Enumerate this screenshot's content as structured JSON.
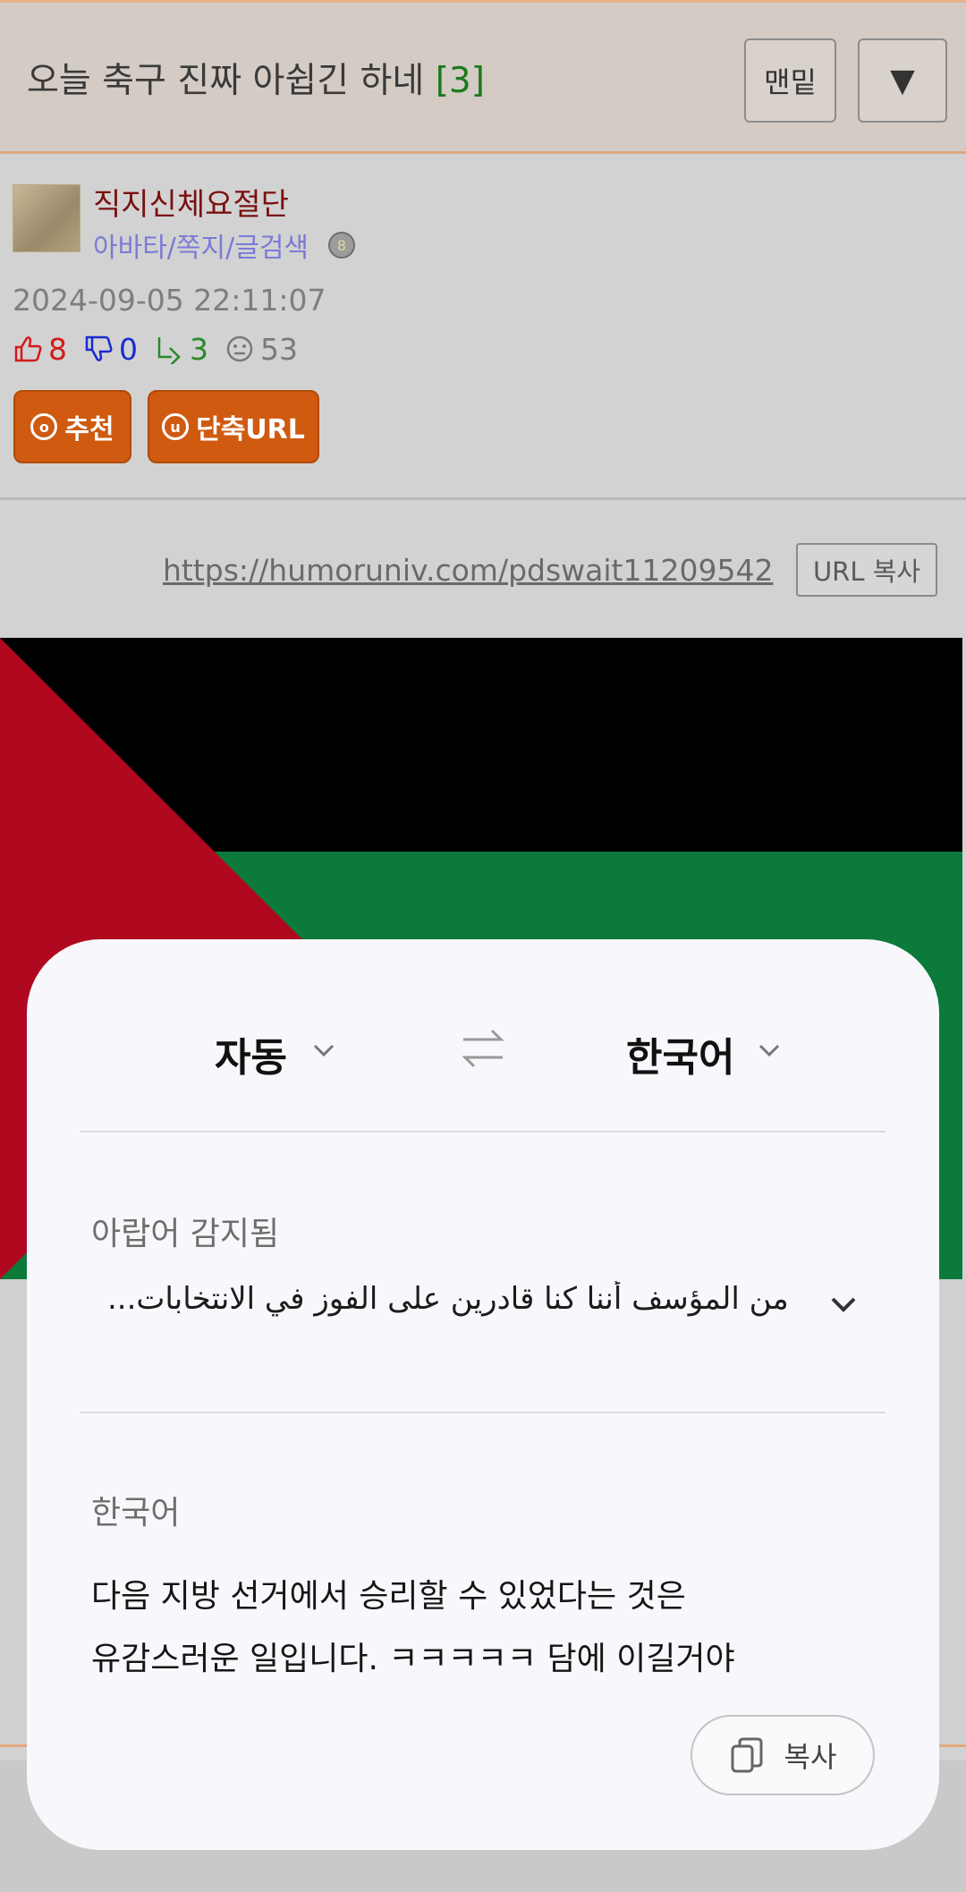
{
  "header": {
    "title": "오늘 축구 진짜 아쉽긴 하네",
    "comment_count": "[3]",
    "bottom_button": "맨밑",
    "down_button": "▼"
  },
  "post": {
    "author": "직지신체요절단",
    "author_links": "아바타/쪽지/글검색",
    "date": "2024-09-05 22:11:07",
    "stats": {
      "likes": "8",
      "dislikes": "0",
      "replies": "3",
      "views": "53"
    },
    "recommend_button": "추천",
    "short_url_button": "단축URL",
    "url": "https://humoruniv.com/pdswait11209542",
    "url_copy_button": "URL 복사"
  },
  "translator": {
    "source_lang": "자동",
    "target_lang": "한국어",
    "detected_label": "아랍어 감지됨",
    "source_text": "من المؤسف أننا كنا قادرين على الفوز في الانتخابات...",
    "target_label": "한국어",
    "translated_line1": "다음 지방 선거에서 승리할 수 있었다는 것은",
    "translated_line2": "유감스러운 일입니다. ㅋㅋㅋㅋㅋ 담에 이길거야",
    "copy_button": "복사"
  },
  "colors": {
    "header_bg": "#d3cbc4",
    "accent_orange": "#cf5a10",
    "flag_red": "#b0081e",
    "flag_green": "#0c7a3a",
    "flag_black": "#000000"
  }
}
